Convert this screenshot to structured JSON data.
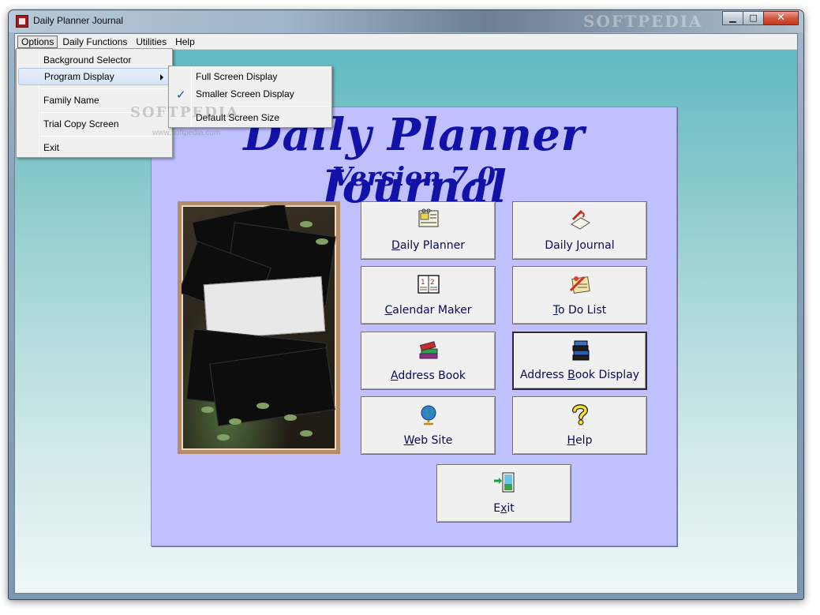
{
  "window": {
    "title": "Daily Planner Journal",
    "watermark": "SOFTPEDIA",
    "minimize_glyph": "▁",
    "maximize_glyph": "□",
    "close_glyph": "✕"
  },
  "menubar": {
    "items": [
      "Options",
      "Daily Functions",
      "Utilities",
      "Help"
    ]
  },
  "options_menu": {
    "items": [
      "Background Selector",
      "Program Display",
      "Family Name",
      "Trial Copy Screen",
      "Exit"
    ]
  },
  "program_display_menu": {
    "items": [
      "Full Screen Display",
      "Smaller Screen Display",
      "Default Screen Size"
    ],
    "checked": "Smaller Screen Display",
    "check_glyph": "✓"
  },
  "overlay_watermark": {
    "big": "SOFTPEDIA",
    "small": "www.softpedia.com"
  },
  "main": {
    "title": "Daily Planner Journal",
    "version": "Version 7.0",
    "buttons": [
      {
        "pre": "",
        "accel": "D",
        "post": "aily Planner",
        "icon": "planner-icon"
      },
      {
        "pre": "Daily ",
        "accel": "J",
        "post": "ournal",
        "icon": "journal-icon"
      },
      {
        "pre": "",
        "accel": "C",
        "post": "alendar Maker",
        "icon": "calendar-icon"
      },
      {
        "pre": "",
        "accel": "T",
        "post": "o Do List",
        "icon": "todo-icon"
      },
      {
        "pre": "",
        "accel": "A",
        "post": "ddress Book",
        "icon": "books-icon"
      },
      {
        "pre": "Address ",
        "accel": "B",
        "post": "ook Display",
        "icon": "books-stack-icon"
      },
      {
        "pre": "",
        "accel": "W",
        "post": "eb Site",
        "icon": "globe-icon"
      },
      {
        "pre": "",
        "accel": "H",
        "post": "elp",
        "icon": "question-icon"
      },
      {
        "pre": "E",
        "accel": "x",
        "post": "it",
        "icon": "exit-door-icon"
      }
    ]
  },
  "colors": {
    "panel": "#bfc0fd",
    "title": "#1212a8",
    "background_top": "#5cb7c0"
  }
}
